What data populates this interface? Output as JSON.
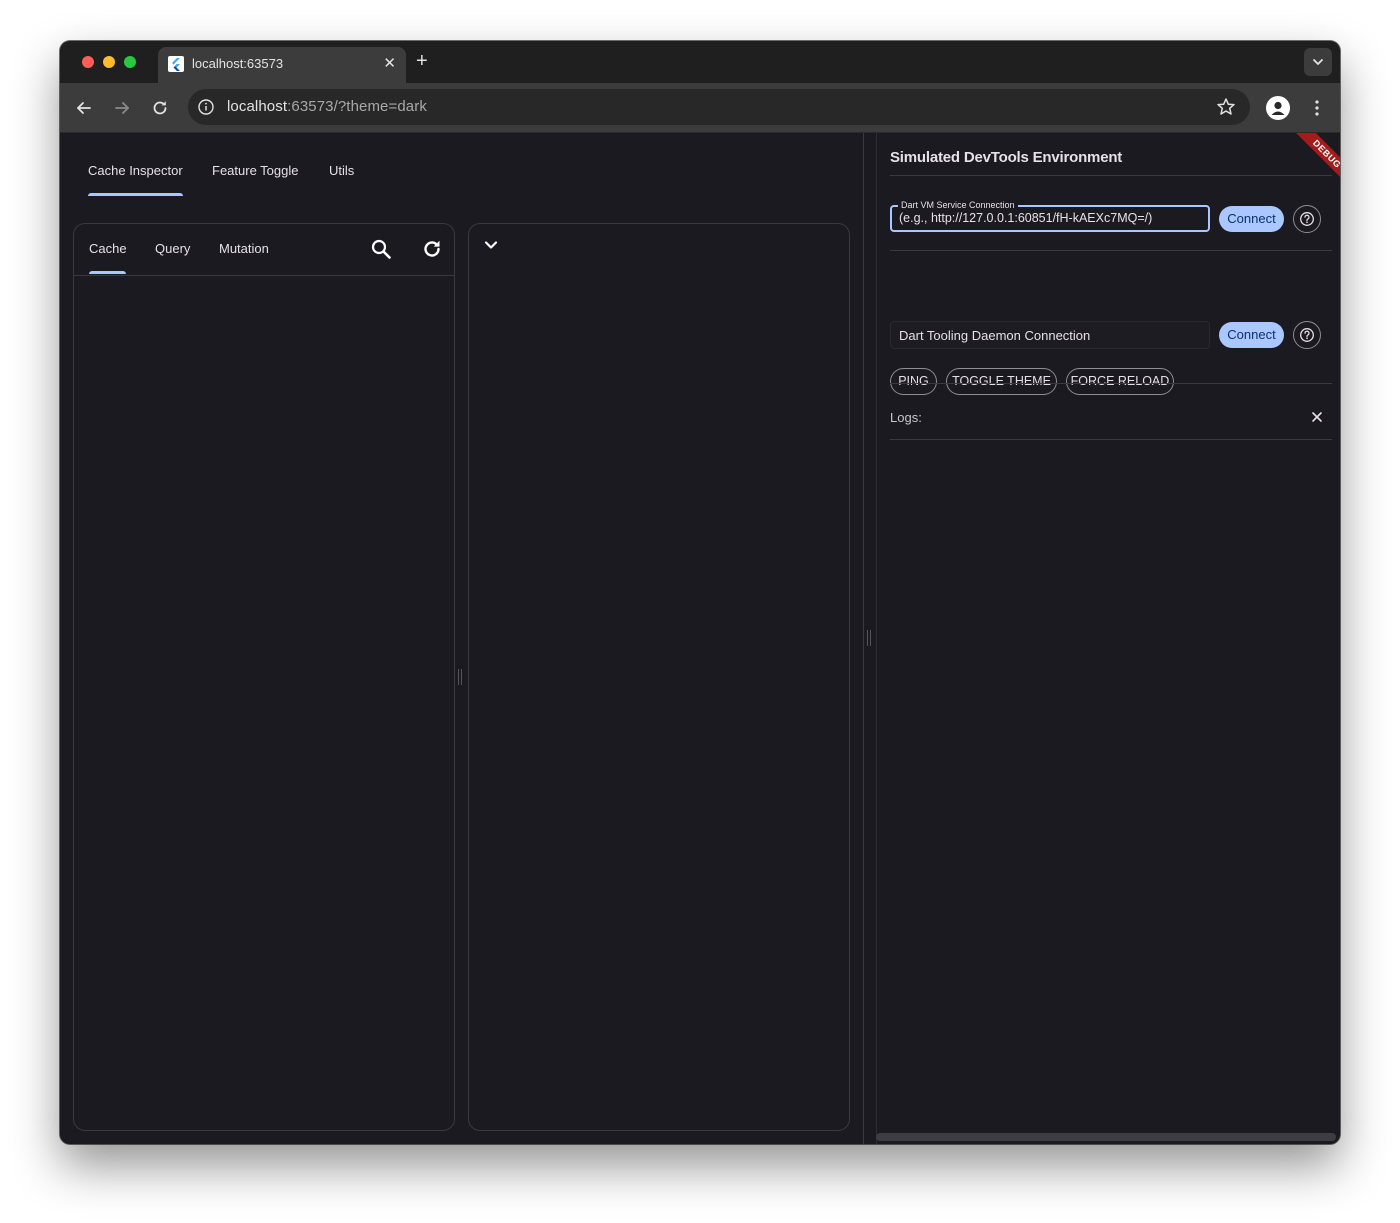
{
  "browser": {
    "tab_title": "localhost:63573",
    "url_host": "localhost",
    "url_rest": ":63573/?theme=dark",
    "icons": [
      "flutter-favicon",
      "close-icon",
      "plus-icon",
      "chevron-down-icon",
      "back-arrow-icon",
      "forward-arrow-icon",
      "reload-icon",
      "info-icon",
      "star-icon",
      "profile-icon",
      "kebab-menu-icon"
    ]
  },
  "app": {
    "main_tabs": [
      "Cache Inspector",
      "Feature Toggle",
      "Utils"
    ],
    "sub_tabs": [
      "Cache",
      "Query",
      "Mutation"
    ],
    "accent": "#aac7ff"
  },
  "devtools": {
    "title": "Simulated DevTools Environment",
    "vm_label": "Dart VM Service Connection",
    "vm_placeholder": "(e.g., http://127.0.0.1:60851/fH-kAEXc7MQ=/)",
    "dtd_placeholder": "Dart Tooling Daemon Connection",
    "connect_label": "Connect",
    "actions": [
      "PING",
      "TOGGLE THEME",
      "FORCE RELOAD"
    ],
    "logs_label": "Logs:",
    "debug_label": "DEBUG"
  }
}
